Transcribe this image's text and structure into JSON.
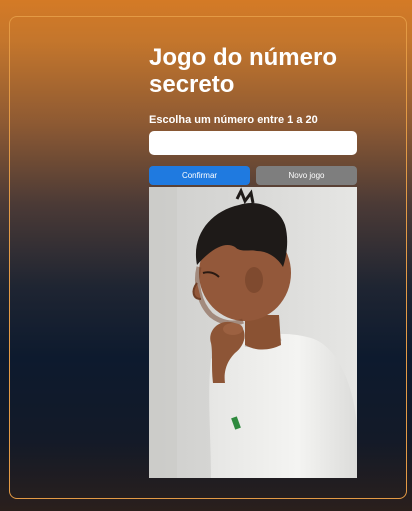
{
  "game": {
    "title": "Jogo do número secreto",
    "prompt": "Escolha um número entre 1 a 20",
    "input": {
      "value": "",
      "placeholder": ""
    },
    "buttons": {
      "confirm_label": "Confirmar",
      "new_game_label": "Novo jogo"
    }
  },
  "colors": {
    "confirm_button": "#1f7ae0",
    "new_game_button": "#7e7e7e",
    "frame_border": "#e39a45"
  },
  "image": {
    "subject": "profile-photo-of-boy"
  }
}
